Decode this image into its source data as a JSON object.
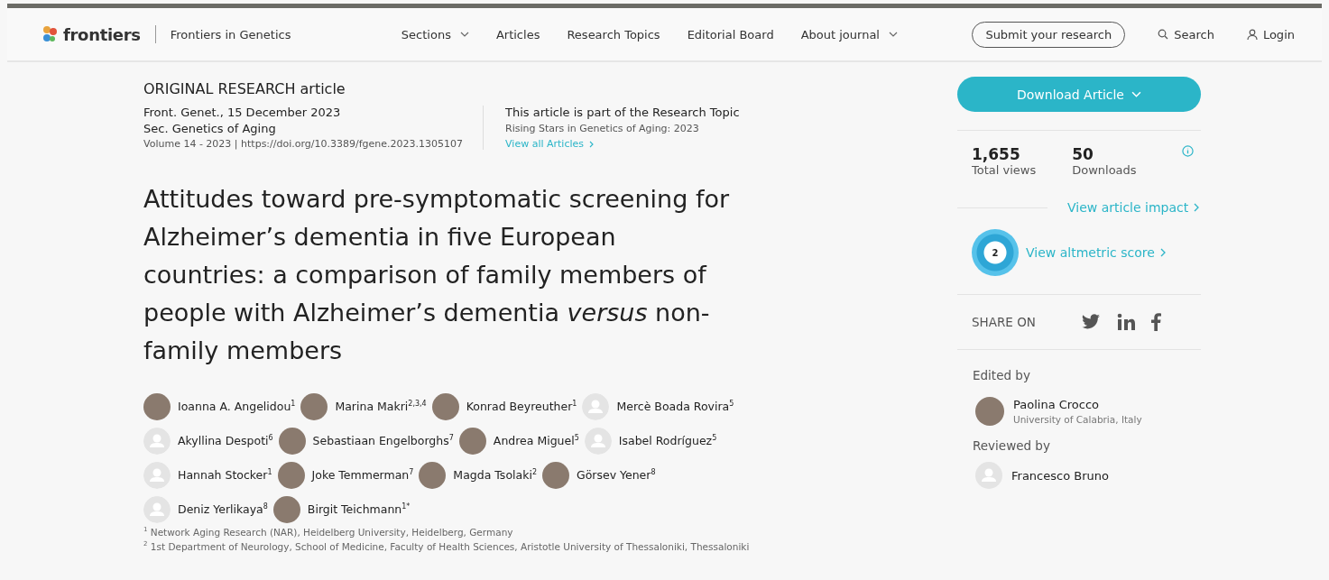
{
  "header": {
    "logo": "frontiers",
    "journal": "Frontiers in Genetics",
    "nav": [
      {
        "label": "Sections",
        "dropdown": true
      },
      {
        "label": "Articles",
        "dropdown": false
      },
      {
        "label": "Research Topics",
        "dropdown": false
      },
      {
        "label": "Editorial Board",
        "dropdown": false
      },
      {
        "label": "About journal",
        "dropdown": true
      }
    ],
    "submit": "Submit your research",
    "search": "Search",
    "login": "Login"
  },
  "article": {
    "type": "ORIGINAL RESEARCH article",
    "citation": "Front. Genet., 15 December 2023",
    "section": "Sec. Genetics of Aging",
    "volume": "Volume 14 - 2023 | https://doi.org/10.3389/fgene.2023.1305107",
    "topic": {
      "heading": "This article is part of the Research Topic",
      "name": "Rising Stars in Genetics of Aging: 2023",
      "link": "View all Articles"
    },
    "title": "Attitudes toward pre-symptomatic screening for Alzheimer’s dementia in five European countries: a comparison of family members of people with Alzheimer’s dementia *versus* non-family members",
    "authors": [
      {
        "name": "Ioanna A. Angelidou$^{1}$",
        "kind": "photo"
      },
      {
        "name": "Marina Makri$^{2,3,4}$",
        "kind": "photo"
      },
      {
        "name": "Konrad Beyreuther$^{1}$",
        "kind": "photo"
      },
      {
        "name": "Mercè Boada Rovira$^{5}$",
        "kind": "placeholder"
      },
      {
        "name": "Akyllina Despoti$^{6}$",
        "kind": "placeholder"
      },
      {
        "name": "Sebastiaan Engelborghs$^{7}$",
        "kind": "photo"
      },
      {
        "name": "Andrea Miguel$^{5}$",
        "kind": "photo"
      },
      {
        "name": "Isabel Rodríguez$^{5}$",
        "kind": "placeholder"
      },
      {
        "name": "Hannah Stocker$^{1}$",
        "kind": "placeholder"
      },
      {
        "name": "Joke Temmerman$^{7}$",
        "kind": "photo"
      },
      {
        "name": "Magda Tsolaki$^{2}$",
        "kind": "photo"
      },
      {
        "name": "Görsev Yener$^{8}$",
        "kind": "photo"
      },
      {
        "name": "Deniz Yerlikaya$^{8}$",
        "kind": "placeholder"
      },
      {
        "name": "Birgit Teichmann$^{1*}$",
        "kind": "photo"
      }
    ],
    "affiliations": [
      "$^{1}$ Network Aging Research (NAR), Heidelberg University, Heidelberg, Germany",
      "$^{2}$ 1st Department of Neurology, School of Medicine, Faculty of Health Sciences, Aristotle University of Thessaloniki, Thessaloniki"
    ]
  },
  "sidebar": {
    "download": "Download Article",
    "metrics": [
      {
        "value": "1,655",
        "label": "Total views"
      },
      {
        "value": "50",
        "label": "Downloads"
      }
    ],
    "impact_link": "View article impact",
    "altmetric": {
      "score": "2",
      "link": "View altmetric score"
    },
    "share_label": "SHARE ON",
    "share": [
      {
        "kind": "twitter"
      },
      {
        "kind": "linkedin"
      },
      {
        "kind": "facebook"
      }
    ],
    "edited_by": {
      "heading": "Edited by",
      "people": [
        {
          "name": "Paolina Crocco",
          "affiliation": "University of Calabria, Italy"
        }
      ]
    },
    "reviewed_by": {
      "heading": "Reviewed by",
      "people": [
        {
          "name": "Francesco Bruno"
        }
      ]
    }
  }
}
